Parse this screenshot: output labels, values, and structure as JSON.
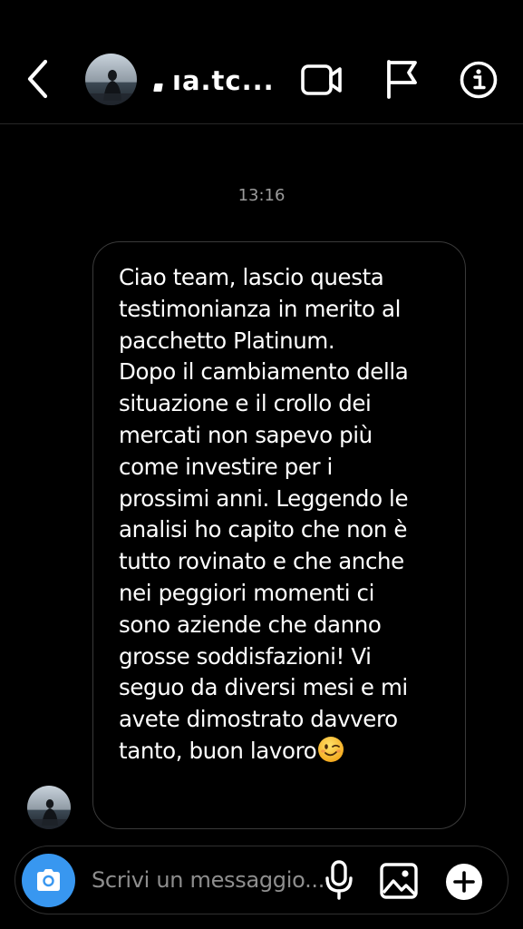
{
  "header": {
    "username": "ıa.tc...",
    "icons": {
      "back": "chevron-left-icon",
      "video": "video-camera-icon",
      "flag": "flag-icon",
      "info": "info-icon"
    }
  },
  "thread": {
    "timestamp": "13:16",
    "message": {
      "text": "Ciao team, lascio questa\ntestimonianza in merito al\npacchetto Platinum.\nDopo il cambiamento della\nsituazione e il crollo dei\nmercati non sapevo più\ncome investire per i\nprossimi anni. Leggendo le\nanalisi ho capito che non è\ntutto rovinato e che anche\nnei peggiori momenti ci\nsono aziende che danno\ngrosse soddisfazioni! Vi\nseguo da diversi mesi e mi\navete dimostrato davvero\ntanto, buon lavoro",
      "emoji": "winking-face-emoji"
    }
  },
  "composer": {
    "placeholder": "Scrivi un messaggio...",
    "value": "",
    "icons": {
      "camera": "camera-icon",
      "mic": "microphone-icon",
      "gallery": "gallery-icon",
      "plus": "plus-circle-icon"
    }
  },
  "colors": {
    "background": "#000000",
    "text": "#ffffff",
    "muted": "#9b9b9b",
    "border": "#3a3a3a",
    "camera_button": "#3897f0"
  }
}
